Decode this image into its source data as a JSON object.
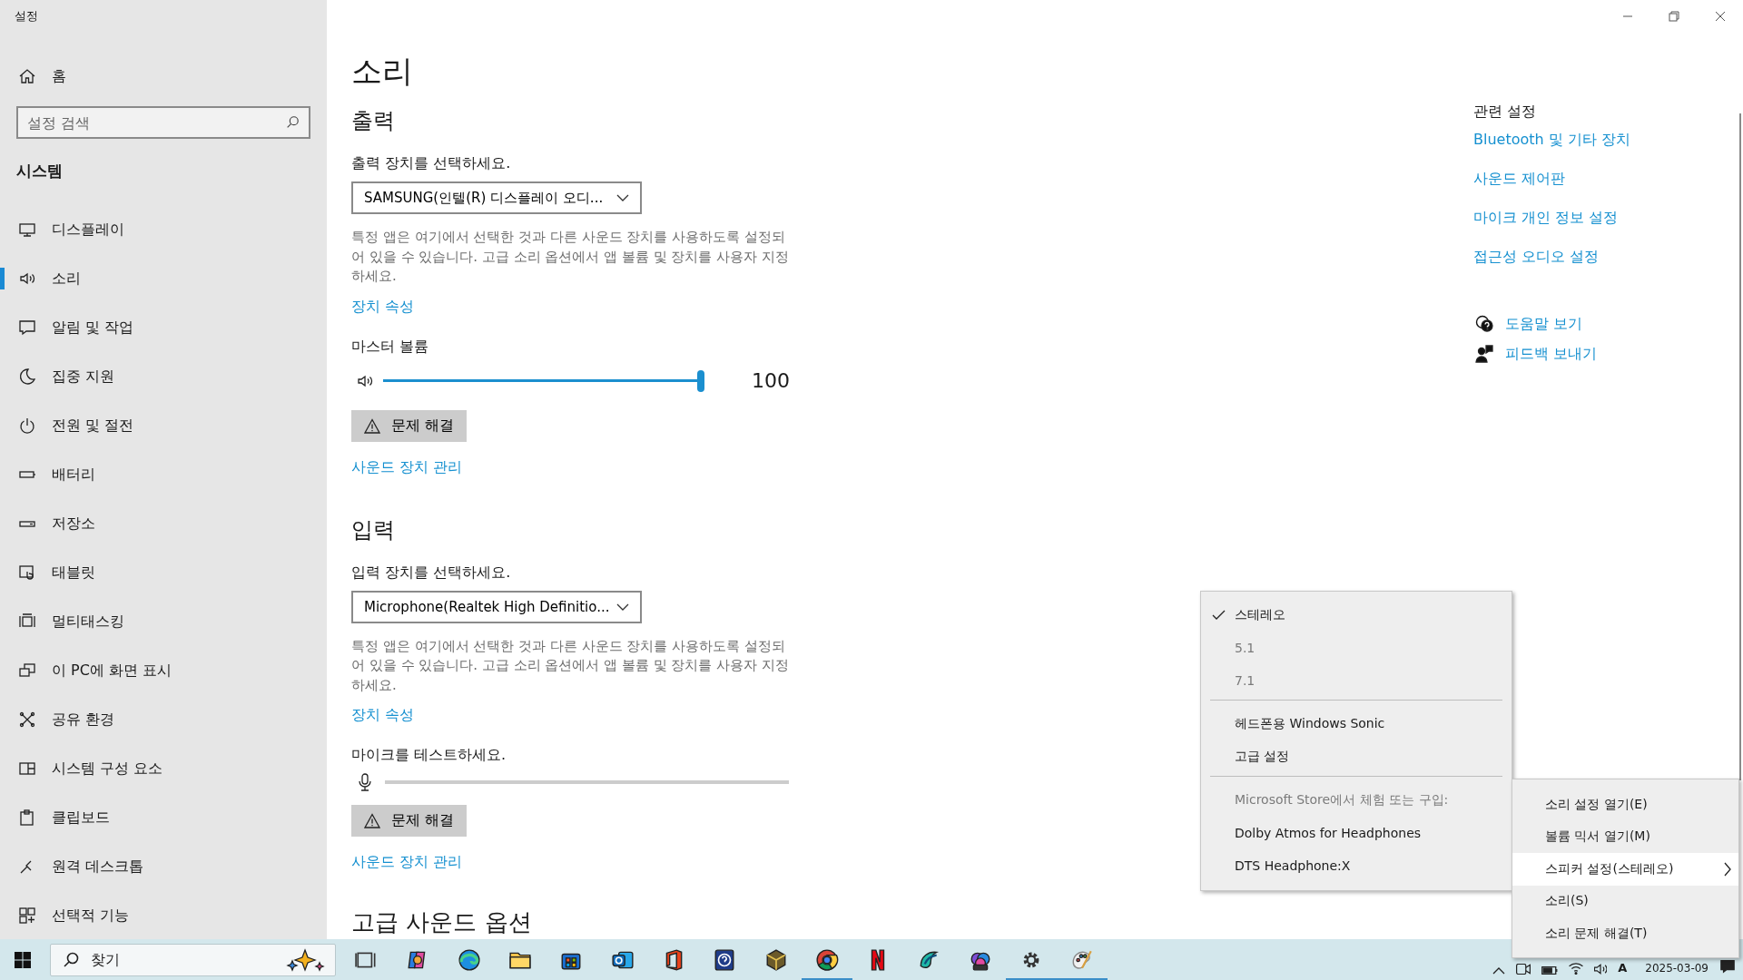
{
  "window": {
    "title": "설정"
  },
  "sidebar": {
    "home": "홈",
    "search": {
      "placeholder": "설정 검색"
    },
    "section": "시스템",
    "items": [
      {
        "kind": "display",
        "label": "디스플레이",
        "selected": false
      },
      {
        "kind": "sound",
        "label": "소리",
        "selected": true
      },
      {
        "kind": "notifications",
        "label": "알림 및 작업",
        "selected": false
      },
      {
        "kind": "focus",
        "label": "집중 지원",
        "selected": false
      },
      {
        "kind": "power",
        "label": "전원 및 절전",
        "selected": false
      },
      {
        "kind": "battery",
        "label": "배터리",
        "selected": false
      },
      {
        "kind": "storage",
        "label": "저장소",
        "selected": false
      },
      {
        "kind": "tablet",
        "label": "태블릿",
        "selected": false
      },
      {
        "kind": "multitask",
        "label": "멀티태스킹",
        "selected": false
      },
      {
        "kind": "project",
        "label": "이 PC에 화면 표시",
        "selected": false
      },
      {
        "kind": "shared",
        "label": "공유 환경",
        "selected": false
      },
      {
        "kind": "components",
        "label": "시스템 구성 요소",
        "selected": false
      },
      {
        "kind": "clipboard",
        "label": "클립보드",
        "selected": false
      },
      {
        "kind": "remote",
        "label": "원격 데스크톱",
        "selected": false
      },
      {
        "kind": "optional",
        "label": "선택적 기능",
        "selected": false
      }
    ]
  },
  "page": {
    "title": "소리",
    "sections": [
      {
        "heading": "출력",
        "prompt": "출력 장치를 선택하세요.",
        "device": "SAMSUNG(인텔(R) 디스플레이 오디...",
        "description": "특정 앱은 여기에서 선택한 것과 다른 사운드 장치를 사용하도록 설정되어 있을 수 있습니다. 고급 소리 옵션에서 앱 볼륨 및 장치를 사용자 지정하세요.",
        "properties_link": "장치 속성",
        "meter": {
          "kind": "volume",
          "label": "마스터 볼륨",
          "level": 1.0,
          "reading": "100"
        },
        "troubleshoot": "문제 해결",
        "manage_link": "사운드 장치 관리"
      },
      {
        "heading": "입력",
        "prompt": "입력 장치를 선택하세요.",
        "device": "Microphone(Realtek High Definitio...",
        "description": "특정 앱은 여기에서 선택한 것과 다른 사운드 장치를 사용하도록 설정되어 있을 수 있습니다. 고급 소리 옵션에서 앱 볼륨 및 장치를 사용자 지정하세요.",
        "properties_link": "장치 속성",
        "meter": {
          "kind": "mic",
          "label": "마이크를 테스트하세요.",
          "level": 0
        },
        "troubleshoot": "문제 해결",
        "manage_link": "사운드 장치 관리"
      }
    ],
    "advanced_heading": "고급 사운드 옵션"
  },
  "related": {
    "heading": "관련 설정",
    "links": [
      "Bluetooth 및 기타 장치",
      "사운드 제어판",
      "마이크 개인 정보 설정",
      "접근성 오디오 설정"
    ],
    "help": [
      {
        "kind": "help",
        "label": "도움말 보기"
      },
      {
        "kind": "feedback",
        "label": "피드백 보내기"
      }
    ]
  },
  "spatial_menu": {
    "items": [
      {
        "kind": "option",
        "label": "스테레오",
        "checked": true,
        "disabled": false
      },
      {
        "kind": "option",
        "label": "5.1",
        "checked": false,
        "disabled": true
      },
      {
        "kind": "option",
        "label": "7.1",
        "checked": false,
        "disabled": true
      },
      {
        "kind": "separator"
      },
      {
        "kind": "option",
        "label": "헤드폰용 Windows Sonic",
        "checked": false,
        "disabled": false
      },
      {
        "kind": "option",
        "label": "고급 설정",
        "checked": false,
        "disabled": false
      },
      {
        "kind": "separator"
      },
      {
        "kind": "caption",
        "label": "Microsoft Store에서 체험 또는 구입:"
      },
      {
        "kind": "option",
        "label": "Dolby Atmos for Headphones",
        "checked": false,
        "disabled": false
      },
      {
        "kind": "option",
        "label": "DTS Headphone:X",
        "checked": false,
        "disabled": false
      }
    ]
  },
  "tray_menu": {
    "items": [
      {
        "label": "소리 설정 열기(E)",
        "selected": false,
        "submenu": false
      },
      {
        "label": "볼륨 믹서 열기(M)",
        "selected": false,
        "submenu": false
      },
      {
        "label": "스피커 설정(스테레오)",
        "selected": true,
        "submenu": true
      },
      {
        "label": "소리(S)",
        "selected": false,
        "submenu": false
      },
      {
        "label": "소리 문제 해결(T)",
        "selected": false,
        "submenu": false
      }
    ]
  },
  "taskbar": {
    "search": {
      "placeholder": "찾기"
    },
    "apps": [
      {
        "kind": "taskview",
        "running": false
      },
      {
        "kind": "copilot",
        "running": false
      },
      {
        "kind": "edge",
        "running": false
      },
      {
        "kind": "explorer",
        "running": false
      },
      {
        "kind": "store",
        "running": false
      },
      {
        "kind": "outlook",
        "running": false
      },
      {
        "kind": "office",
        "running": false
      },
      {
        "kind": "help",
        "running": false
      },
      {
        "kind": "cube",
        "running": false
      },
      {
        "kind": "chrome",
        "running": true
      },
      {
        "kind": "netflix",
        "running": false
      },
      {
        "kind": "swirl",
        "running": false
      },
      {
        "kind": "m365",
        "running": false
      },
      {
        "kind": "settings",
        "running": true
      },
      {
        "kind": "paint",
        "running": true
      }
    ],
    "tray": {
      "ime": "A",
      "date": "2025-03-09"
    }
  }
}
